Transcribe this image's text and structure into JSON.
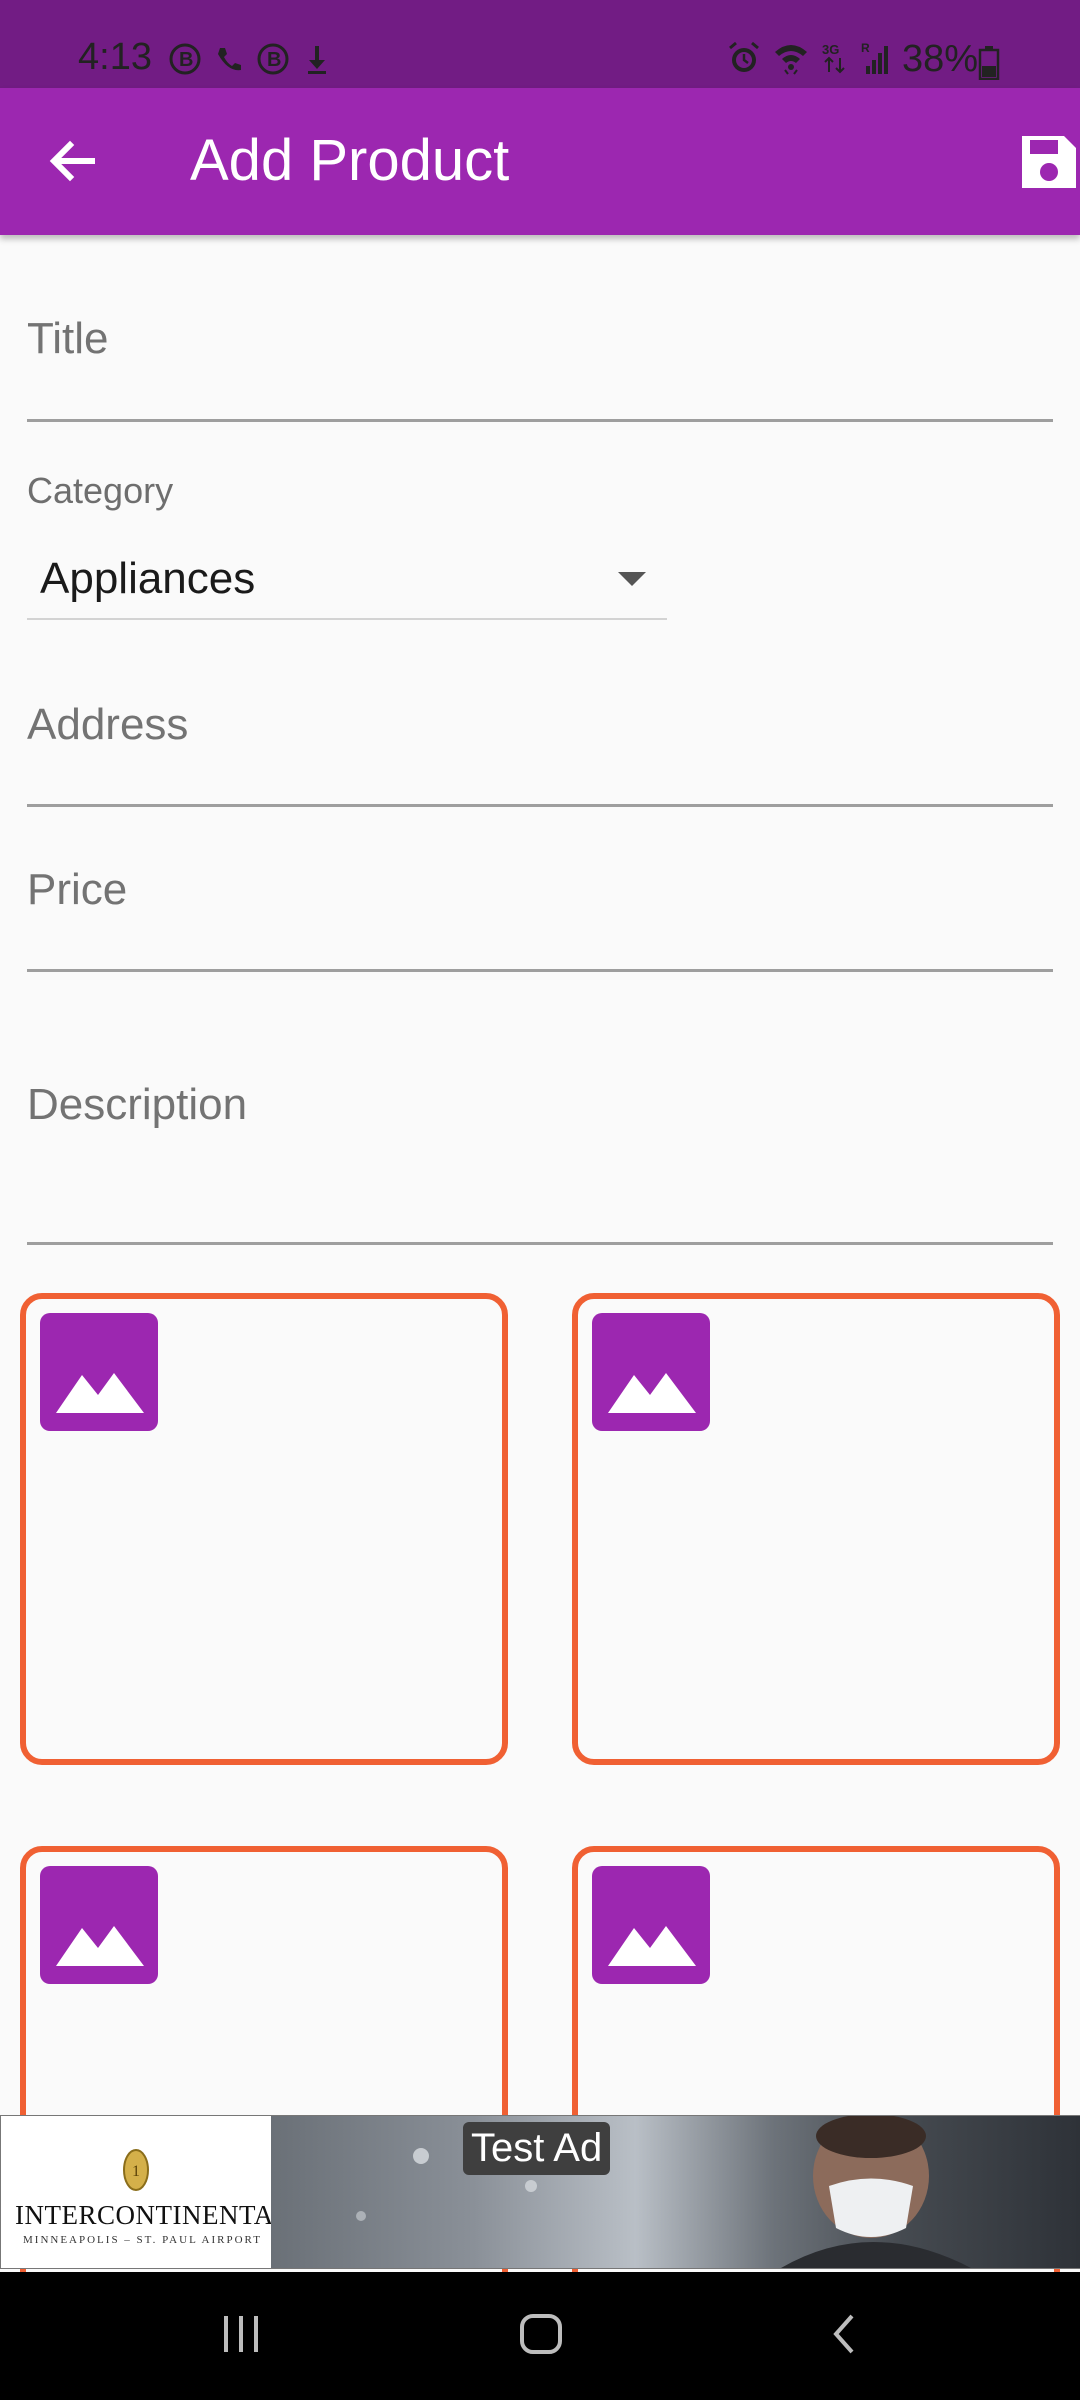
{
  "status_bar": {
    "time": "4:13",
    "battery": "38%",
    "left_icons": [
      "b-notification-icon",
      "wifi-call-icon",
      "b-notification-icon",
      "download-icon"
    ],
    "right_icons": [
      "alarm-icon",
      "wifi-icon",
      "3g-icon",
      "signal-icon",
      "battery-icon"
    ]
  },
  "app_bar": {
    "title": "Add Product",
    "background": "#9c27b0",
    "back_icon": "arrow-back-icon",
    "save_icon": "save-icon"
  },
  "form": {
    "title_placeholder": "Title",
    "category_label": "Category",
    "category_value": "Appliances",
    "address_placeholder": "Address",
    "price_placeholder": "Price",
    "description_placeholder": "Description"
  },
  "image_slots": [
    {
      "icon": "image-placeholder-icon"
    },
    {
      "icon": "image-placeholder-icon"
    },
    {
      "icon": "image-placeholder-icon"
    },
    {
      "icon": "image-placeholder-icon"
    }
  ],
  "ad": {
    "label": "Test Ad",
    "brand": "INTERCONTINENTAL.",
    "subtitle": "MINNEAPOLIS – ST. PAUL AIRPORT"
  },
  "nav_bar": {
    "icons": [
      "recents-icon",
      "home-icon",
      "back-icon"
    ]
  },
  "colors": {
    "primary": "#9c27b0",
    "status_bar": "#721c84",
    "tile_border": "#f06033"
  }
}
